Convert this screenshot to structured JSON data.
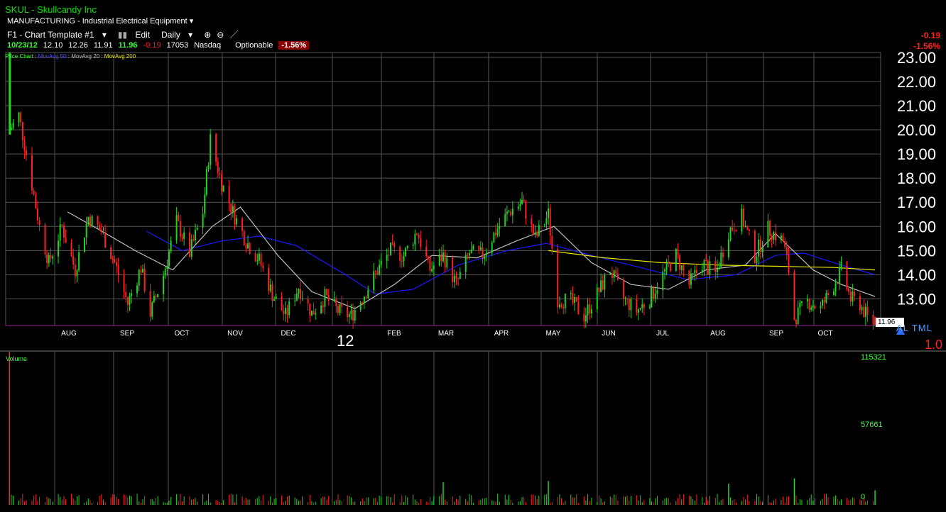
{
  "header": {
    "symbol": "SKUL - Skullcandy Inc",
    "industry": "MANUFACTURING - Industrial Electrical Equipment",
    "template": "F1 - Chart Template #1",
    "edit_label": "Edit",
    "interval": "Daily",
    "date": "10/23/12",
    "open": "12.10",
    "high": "12.26",
    "low": "11.91",
    "close": "11.96",
    "change": "-0.19",
    "volume": "17053",
    "exchange": "Nasdaq",
    "optionable": "Optionable",
    "change_pct": "-1.56%",
    "right_change": "-0.19",
    "right_change_pct": "-1.56%"
  },
  "legend": {
    "price_chart": "Price Chart",
    "ma50": "MovAvg 50",
    "ma20": "MovAvg 20",
    "ma200": "MovAvg 200"
  },
  "price_tag": "11.96",
  "altml": "AL TML",
  "ratio": "1.0",
  "year_label": "12",
  "volume_label": "Volume",
  "colors": {
    "up": "#22d322",
    "down": "#ff2020",
    "ma50": "#1a1aff",
    "ma20": "#bfbfbf",
    "ma200": "#e6e600",
    "grid": "#555555"
  },
  "chart_data": {
    "type": "candlestick",
    "x_ticks": [
      "AUG",
      "SEP",
      "OCT",
      "NOV",
      "DEC",
      "FEB",
      "MAR",
      "APR",
      "MAY",
      "JUN",
      "JUL",
      "AUG",
      "SEP",
      "OCT"
    ],
    "y_ticks": [
      "23.00",
      "22.00",
      "21.00",
      "20.00",
      "19.00",
      "18.00",
      "17.00",
      "16.00",
      "15.00",
      "14.00",
      "13.00"
    ],
    "ylim": [
      11.9,
      23.2
    ],
    "volume_ticks": [
      "115321",
      "57661",
      "0"
    ],
    "volume_lim": [
      0,
      115321
    ],
    "close_series": [
      {
        "date": "2011-07-20",
        "value": 20.0
      },
      {
        "date": "2011-07-25",
        "value": 20.6
      },
      {
        "date": "2011-07-29",
        "value": 19.0
      },
      {
        "date": "2011-08-05",
        "value": 16.0
      },
      {
        "date": "2011-08-10",
        "value": 14.5
      },
      {
        "date": "2011-08-17",
        "value": 16.0
      },
      {
        "date": "2011-08-24",
        "value": 14.2
      },
      {
        "date": "2011-08-31",
        "value": 16.4
      },
      {
        "date": "2011-09-07",
        "value": 15.8
      },
      {
        "date": "2011-09-14",
        "value": 14.5
      },
      {
        "date": "2011-09-21",
        "value": 12.8
      },
      {
        "date": "2011-09-28",
        "value": 14.3
      },
      {
        "date": "2011-10-03",
        "value": 12.4
      },
      {
        "date": "2011-10-10",
        "value": 14.0
      },
      {
        "date": "2011-10-17",
        "value": 16.2
      },
      {
        "date": "2011-10-24",
        "value": 14.9
      },
      {
        "date": "2011-10-31",
        "value": 16.6
      },
      {
        "date": "2011-11-04",
        "value": 19.6
      },
      {
        "date": "2011-11-10",
        "value": 17.8
      },
      {
        "date": "2011-11-16",
        "value": 16.6
      },
      {
        "date": "2011-11-23",
        "value": 15.4
      },
      {
        "date": "2011-11-30",
        "value": 14.6
      },
      {
        "date": "2011-12-07",
        "value": 13.2
      },
      {
        "date": "2011-12-14",
        "value": 12.3
      },
      {
        "date": "2011-12-21",
        "value": 13.5
      },
      {
        "date": "2011-12-28",
        "value": 12.4
      },
      {
        "date": "2012-01-04",
        "value": 13.1
      },
      {
        "date": "2012-01-11",
        "value": 12.5
      },
      {
        "date": "2012-01-18",
        "value": 12.3
      },
      {
        "date": "2012-01-25",
        "value": 13.2
      },
      {
        "date": "2012-02-01",
        "value": 14.2
      },
      {
        "date": "2012-02-08",
        "value": 15.0
      },
      {
        "date": "2012-02-15",
        "value": 14.8
      },
      {
        "date": "2012-02-22",
        "value": 15.8
      },
      {
        "date": "2012-02-29",
        "value": 14.2
      },
      {
        "date": "2012-03-07",
        "value": 14.8
      },
      {
        "date": "2012-03-14",
        "value": 13.6
      },
      {
        "date": "2012-03-21",
        "value": 14.9
      },
      {
        "date": "2012-03-28",
        "value": 14.8
      },
      {
        "date": "2012-04-04",
        "value": 15.8
      },
      {
        "date": "2012-04-11",
        "value": 16.6
      },
      {
        "date": "2012-04-18",
        "value": 17.0
      },
      {
        "date": "2012-04-25",
        "value": 15.5
      },
      {
        "date": "2012-05-02",
        "value": 16.5
      },
      {
        "date": "2012-05-07",
        "value": 13.0
      },
      {
        "date": "2012-05-14",
        "value": 12.9
      },
      {
        "date": "2012-05-21",
        "value": 12.3
      },
      {
        "date": "2012-05-28",
        "value": 13.2
      },
      {
        "date": "2012-06-04",
        "value": 14.2
      },
      {
        "date": "2012-06-11",
        "value": 13.0
      },
      {
        "date": "2012-06-18",
        "value": 12.5
      },
      {
        "date": "2012-06-25",
        "value": 13.0
      },
      {
        "date": "2012-07-02",
        "value": 14.0
      },
      {
        "date": "2012-07-09",
        "value": 14.8
      },
      {
        "date": "2012-07-16",
        "value": 13.6
      },
      {
        "date": "2012-07-23",
        "value": 14.5
      },
      {
        "date": "2012-07-30",
        "value": 14.0
      },
      {
        "date": "2012-08-06",
        "value": 15.8
      },
      {
        "date": "2012-08-13",
        "value": 16.4
      },
      {
        "date": "2012-08-20",
        "value": 14.8
      },
      {
        "date": "2012-08-27",
        "value": 15.9
      },
      {
        "date": "2012-09-04",
        "value": 15.4
      },
      {
        "date": "2012-09-07",
        "value": 14.2
      },
      {
        "date": "2012-09-10",
        "value": 12.2
      },
      {
        "date": "2012-09-17",
        "value": 12.9
      },
      {
        "date": "2012-09-24",
        "value": 12.6
      },
      {
        "date": "2012-10-01",
        "value": 13.6
      },
      {
        "date": "2012-10-05",
        "value": 14.2
      },
      {
        "date": "2012-10-10",
        "value": 13.0
      },
      {
        "date": "2012-10-15",
        "value": 12.8
      },
      {
        "date": "2012-10-19",
        "value": 12.2
      },
      {
        "date": "2012-10-23",
        "value": 11.96
      }
    ],
    "ma50": [
      {
        "date": "2011-10-01",
        "value": 15.8
      },
      {
        "date": "2011-10-20",
        "value": 15.0
      },
      {
        "date": "2011-11-10",
        "value": 15.4
      },
      {
        "date": "2011-11-30",
        "value": 15.6
      },
      {
        "date": "2011-12-20",
        "value": 15.2
      },
      {
        "date": "2012-01-15",
        "value": 14.0
      },
      {
        "date": "2012-01-31",
        "value": 13.2
      },
      {
        "date": "2012-02-20",
        "value": 13.4
      },
      {
        "date": "2012-03-15",
        "value": 14.4
      },
      {
        "date": "2012-04-10",
        "value": 15.0
      },
      {
        "date": "2012-05-01",
        "value": 15.3
      },
      {
        "date": "2012-05-25",
        "value": 14.8
      },
      {
        "date": "2012-06-20",
        "value": 14.3
      },
      {
        "date": "2012-07-15",
        "value": 13.8
      },
      {
        "date": "2012-08-10",
        "value": 14.0
      },
      {
        "date": "2012-08-31",
        "value": 14.8
      },
      {
        "date": "2012-09-15",
        "value": 14.9
      },
      {
        "date": "2012-10-05",
        "value": 14.4
      },
      {
        "date": "2012-10-23",
        "value": 14.0
      }
    ],
    "ma20": [
      {
        "date": "2011-08-20",
        "value": 16.6
      },
      {
        "date": "2011-09-05",
        "value": 15.9
      },
      {
        "date": "2011-09-25",
        "value": 15.0
      },
      {
        "date": "2011-10-15",
        "value": 14.2
      },
      {
        "date": "2011-11-05",
        "value": 16.0
      },
      {
        "date": "2011-11-20",
        "value": 16.8
      },
      {
        "date": "2011-12-10",
        "value": 14.8
      },
      {
        "date": "2011-12-28",
        "value": 13.3
      },
      {
        "date": "2012-01-20",
        "value": 12.6
      },
      {
        "date": "2012-02-10",
        "value": 13.6
      },
      {
        "date": "2012-03-01",
        "value": 14.8
      },
      {
        "date": "2012-03-25",
        "value": 14.7
      },
      {
        "date": "2012-04-15",
        "value": 15.4
      },
      {
        "date": "2012-05-05",
        "value": 16.0
      },
      {
        "date": "2012-05-25",
        "value": 14.5
      },
      {
        "date": "2012-06-15",
        "value": 13.6
      },
      {
        "date": "2012-07-05",
        "value": 13.4
      },
      {
        "date": "2012-07-25",
        "value": 14.2
      },
      {
        "date": "2012-08-15",
        "value": 14.4
      },
      {
        "date": "2012-08-31",
        "value": 15.7
      },
      {
        "date": "2012-09-20",
        "value": 14.2
      },
      {
        "date": "2012-10-05",
        "value": 13.6
      },
      {
        "date": "2012-10-23",
        "value": 13.1
      }
    ],
    "ma200": [
      {
        "date": "2012-05-02",
        "value": 15.0
      },
      {
        "date": "2012-06-01",
        "value": 14.7
      },
      {
        "date": "2012-07-01",
        "value": 14.5
      },
      {
        "date": "2012-08-01",
        "value": 14.4
      },
      {
        "date": "2012-09-01",
        "value": 14.35
      },
      {
        "date": "2012-10-01",
        "value": 14.3
      },
      {
        "date": "2012-10-23",
        "value": 14.2
      }
    ],
    "volume_spikes": [
      {
        "date": "2011-07-20",
        "value": 115321
      },
      {
        "date": "2012-03-07",
        "value": 17000
      },
      {
        "date": "2012-05-02",
        "value": 18000
      },
      {
        "date": "2012-08-06",
        "value": 16000
      },
      {
        "date": "2012-09-10",
        "value": 20000
      },
      {
        "date": "2012-10-23",
        "value": 11000
      }
    ]
  }
}
